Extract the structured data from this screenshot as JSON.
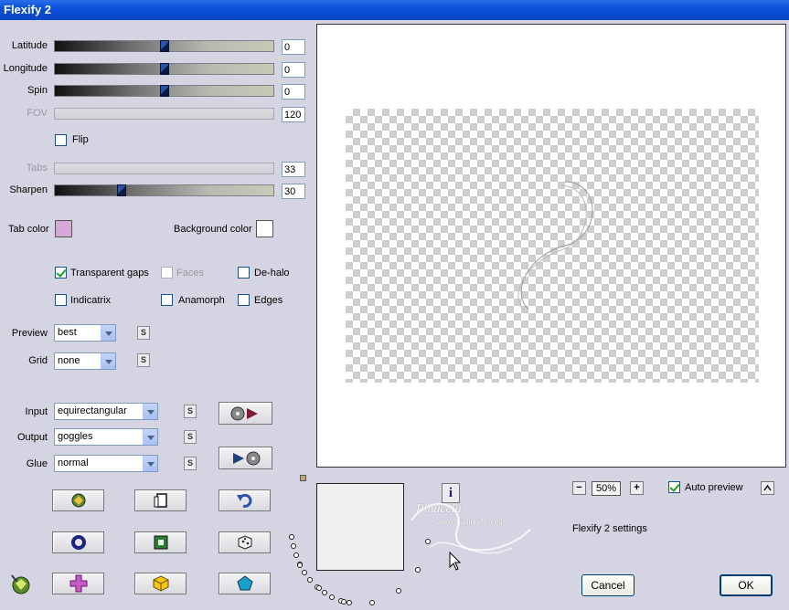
{
  "window": {
    "title": "Flexify 2"
  },
  "sliders": {
    "latitude": {
      "label": "Latitude",
      "value": "0",
      "position": 0.5
    },
    "longitude": {
      "label": "Longitude",
      "value": "0",
      "position": 0.5
    },
    "spin": {
      "label": "Spin",
      "value": "0",
      "position": 0.5
    },
    "fov": {
      "label": "FOV",
      "value": "120"
    },
    "tabs": {
      "label": "Tabs",
      "value": "33"
    },
    "sharpen": {
      "label": "Sharpen",
      "value": "30",
      "position": 0.3
    }
  },
  "flip": {
    "label": "Flip",
    "checked": false
  },
  "colors": {
    "tab_label": "Tab color",
    "tab_color": "#d8a9d8",
    "background_label": "Background color",
    "background_color": "#ffffff"
  },
  "options": {
    "transparent_gaps": {
      "label": "Transparent gaps",
      "checked": true
    },
    "faces": {
      "label": "Faces",
      "checked": false
    },
    "de_halo": {
      "label": "De-halo",
      "checked": false
    },
    "indicatrix": {
      "label": "Indicatrix",
      "checked": false
    },
    "anamorph": {
      "label": "Anamorph",
      "checked": false
    },
    "edges": {
      "label": "Edges",
      "checked": false
    }
  },
  "selects": {
    "preview": {
      "label": "Preview",
      "value": "best"
    },
    "grid": {
      "label": "Grid",
      "value": "none"
    },
    "input": {
      "label": "Input",
      "value": "equirectangular"
    },
    "output": {
      "label": "Output",
      "value": "goggles"
    },
    "glue": {
      "label": "Glue",
      "value": "normal"
    }
  },
  "small_button_label": "S",
  "zoom": {
    "minus": "−",
    "value": "50%",
    "plus": "+"
  },
  "auto_preview": {
    "label": "Auto preview",
    "checked": true
  },
  "settings_label": "Flexify 2 settings",
  "info_label": "i",
  "buttons": {
    "cancel": "Cancel",
    "ok": "OK"
  },
  "watermark": "Pinuccia",
  "watermark_sub": "www.madigrafica.eu",
  "icons": {
    "accent": "#2b52a8",
    "preset_load": "film-load-icon",
    "preset_save": "film-save-icon"
  }
}
